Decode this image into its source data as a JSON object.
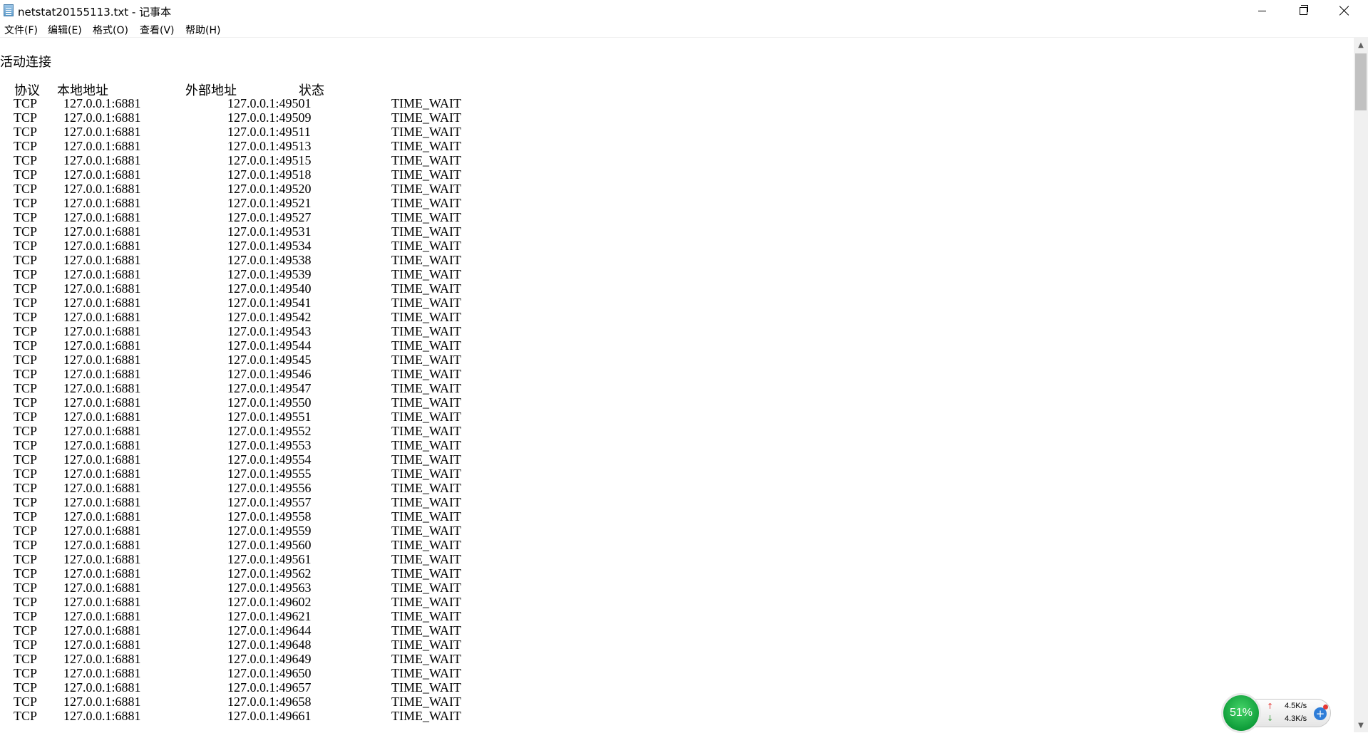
{
  "window": {
    "title": "netstat20155113.txt - 记事本",
    "controls": {
      "minimize": "",
      "maximize": "",
      "close": ""
    }
  },
  "menu": [
    {
      "label": "文件(F)"
    },
    {
      "label": "编辑(E)"
    },
    {
      "label": "格式(O)"
    },
    {
      "label": "查看(V)"
    },
    {
      "label": "帮助(H)"
    }
  ],
  "document": {
    "heading": "活动连接",
    "columns": {
      "proto": "协议",
      "local": "本地地址",
      "foreign": "外部地址",
      "state": "状态"
    },
    "rows": [
      {
        "proto": "TCP",
        "local": "127.0.0.1:6881",
        "foreign": "127.0.0.1:49501",
        "state": "TIME_WAIT"
      },
      {
        "proto": "TCP",
        "local": "127.0.0.1:6881",
        "foreign": "127.0.0.1:49509",
        "state": "TIME_WAIT"
      },
      {
        "proto": "TCP",
        "local": "127.0.0.1:6881",
        "foreign": "127.0.0.1:49511",
        "state": "TIME_WAIT"
      },
      {
        "proto": "TCP",
        "local": "127.0.0.1:6881",
        "foreign": "127.0.0.1:49513",
        "state": "TIME_WAIT"
      },
      {
        "proto": "TCP",
        "local": "127.0.0.1:6881",
        "foreign": "127.0.0.1:49515",
        "state": "TIME_WAIT"
      },
      {
        "proto": "TCP",
        "local": "127.0.0.1:6881",
        "foreign": "127.0.0.1:49518",
        "state": "TIME_WAIT"
      },
      {
        "proto": "TCP",
        "local": "127.0.0.1:6881",
        "foreign": "127.0.0.1:49520",
        "state": "TIME_WAIT"
      },
      {
        "proto": "TCP",
        "local": "127.0.0.1:6881",
        "foreign": "127.0.0.1:49521",
        "state": "TIME_WAIT"
      },
      {
        "proto": "TCP",
        "local": "127.0.0.1:6881",
        "foreign": "127.0.0.1:49527",
        "state": "TIME_WAIT"
      },
      {
        "proto": "TCP",
        "local": "127.0.0.1:6881",
        "foreign": "127.0.0.1:49531",
        "state": "TIME_WAIT"
      },
      {
        "proto": "TCP",
        "local": "127.0.0.1:6881",
        "foreign": "127.0.0.1:49534",
        "state": "TIME_WAIT"
      },
      {
        "proto": "TCP",
        "local": "127.0.0.1:6881",
        "foreign": "127.0.0.1:49538",
        "state": "TIME_WAIT"
      },
      {
        "proto": "TCP",
        "local": "127.0.0.1:6881",
        "foreign": "127.0.0.1:49539",
        "state": "TIME_WAIT"
      },
      {
        "proto": "TCP",
        "local": "127.0.0.1:6881",
        "foreign": "127.0.0.1:49540",
        "state": "TIME_WAIT"
      },
      {
        "proto": "TCP",
        "local": "127.0.0.1:6881",
        "foreign": "127.0.0.1:49541",
        "state": "TIME_WAIT"
      },
      {
        "proto": "TCP",
        "local": "127.0.0.1:6881",
        "foreign": "127.0.0.1:49542",
        "state": "TIME_WAIT"
      },
      {
        "proto": "TCP",
        "local": "127.0.0.1:6881",
        "foreign": "127.0.0.1:49543",
        "state": "TIME_WAIT"
      },
      {
        "proto": "TCP",
        "local": "127.0.0.1:6881",
        "foreign": "127.0.0.1:49544",
        "state": "TIME_WAIT"
      },
      {
        "proto": "TCP",
        "local": "127.0.0.1:6881",
        "foreign": "127.0.0.1:49545",
        "state": "TIME_WAIT"
      },
      {
        "proto": "TCP",
        "local": "127.0.0.1:6881",
        "foreign": "127.0.0.1:49546",
        "state": "TIME_WAIT"
      },
      {
        "proto": "TCP",
        "local": "127.0.0.1:6881",
        "foreign": "127.0.0.1:49547",
        "state": "TIME_WAIT"
      },
      {
        "proto": "TCP",
        "local": "127.0.0.1:6881",
        "foreign": "127.0.0.1:49550",
        "state": "TIME_WAIT"
      },
      {
        "proto": "TCP",
        "local": "127.0.0.1:6881",
        "foreign": "127.0.0.1:49551",
        "state": "TIME_WAIT"
      },
      {
        "proto": "TCP",
        "local": "127.0.0.1:6881",
        "foreign": "127.0.0.1:49552",
        "state": "TIME_WAIT"
      },
      {
        "proto": "TCP",
        "local": "127.0.0.1:6881",
        "foreign": "127.0.0.1:49553",
        "state": "TIME_WAIT"
      },
      {
        "proto": "TCP",
        "local": "127.0.0.1:6881",
        "foreign": "127.0.0.1:49554",
        "state": "TIME_WAIT"
      },
      {
        "proto": "TCP",
        "local": "127.0.0.1:6881",
        "foreign": "127.0.0.1:49555",
        "state": "TIME_WAIT"
      },
      {
        "proto": "TCP",
        "local": "127.0.0.1:6881",
        "foreign": "127.0.0.1:49556",
        "state": "TIME_WAIT"
      },
      {
        "proto": "TCP",
        "local": "127.0.0.1:6881",
        "foreign": "127.0.0.1:49557",
        "state": "TIME_WAIT"
      },
      {
        "proto": "TCP",
        "local": "127.0.0.1:6881",
        "foreign": "127.0.0.1:49558",
        "state": "TIME_WAIT"
      },
      {
        "proto": "TCP",
        "local": "127.0.0.1:6881",
        "foreign": "127.0.0.1:49559",
        "state": "TIME_WAIT"
      },
      {
        "proto": "TCP",
        "local": "127.0.0.1:6881",
        "foreign": "127.0.0.1:49560",
        "state": "TIME_WAIT"
      },
      {
        "proto": "TCP",
        "local": "127.0.0.1:6881",
        "foreign": "127.0.0.1:49561",
        "state": "TIME_WAIT"
      },
      {
        "proto": "TCP",
        "local": "127.0.0.1:6881",
        "foreign": "127.0.0.1:49562",
        "state": "TIME_WAIT"
      },
      {
        "proto": "TCP",
        "local": "127.0.0.1:6881",
        "foreign": "127.0.0.1:49563",
        "state": "TIME_WAIT"
      },
      {
        "proto": "TCP",
        "local": "127.0.0.1:6881",
        "foreign": "127.0.0.1:49602",
        "state": "TIME_WAIT"
      },
      {
        "proto": "TCP",
        "local": "127.0.0.1:6881",
        "foreign": "127.0.0.1:49621",
        "state": "TIME_WAIT"
      },
      {
        "proto": "TCP",
        "local": "127.0.0.1:6881",
        "foreign": "127.0.0.1:49644",
        "state": "TIME_WAIT"
      },
      {
        "proto": "TCP",
        "local": "127.0.0.1:6881",
        "foreign": "127.0.0.1:49648",
        "state": "TIME_WAIT"
      },
      {
        "proto": "TCP",
        "local": "127.0.0.1:6881",
        "foreign": "127.0.0.1:49649",
        "state": "TIME_WAIT"
      },
      {
        "proto": "TCP",
        "local": "127.0.0.1:6881",
        "foreign": "127.0.0.1:49650",
        "state": "TIME_WAIT"
      },
      {
        "proto": "TCP",
        "local": "127.0.0.1:6881",
        "foreign": "127.0.0.1:49657",
        "state": "TIME_WAIT"
      },
      {
        "proto": "TCP",
        "local": "127.0.0.1:6881",
        "foreign": "127.0.0.1:49658",
        "state": "TIME_WAIT"
      },
      {
        "proto": "TCP",
        "local": "127.0.0.1:6881",
        "foreign": "127.0.0.1:49661",
        "state": "TIME_WAIT"
      }
    ]
  },
  "scrollbar": {
    "up_arrow": "▲",
    "down_arrow": "▼"
  },
  "net_monitor": {
    "percent": "51%",
    "upload": "4.5K/s",
    "download": "4.3K/s",
    "upload_arrow": "↑",
    "download_arrow": "↓",
    "plus": "+",
    "circle_color": "#1aa84a",
    "plus_color": "#2e7dd8"
  }
}
